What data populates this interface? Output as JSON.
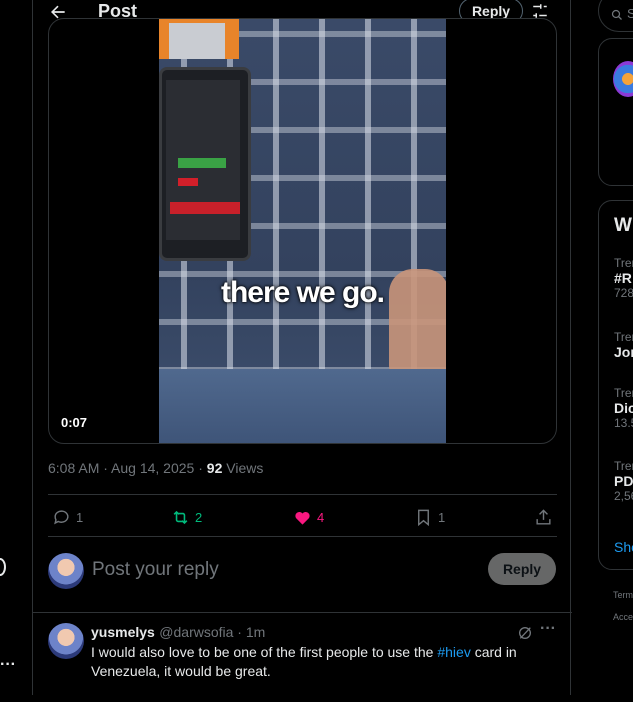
{
  "header": {
    "title": "Post",
    "reply_button": "Reply"
  },
  "media": {
    "caption": "there we go.",
    "duration": "0:07"
  },
  "post_meta": {
    "time": "6:08 AM · Aug 14, 2025 · ",
    "views_count": "92",
    "views_label": " Views"
  },
  "actions": {
    "replies": "1",
    "reposts": "2",
    "likes": "4",
    "bookmarks": "1"
  },
  "colors": {
    "repost": "#00ba7c",
    "like": "#f91880",
    "link": "#1d9bf0",
    "border": "#2f3336"
  },
  "composer": {
    "placeholder": "Post your reply",
    "reply_button": "Reply"
  },
  "comment": {
    "name": "yusmelys",
    "handle": "@darwsofia · 1m",
    "text_before": "I would also love to be one of the first people to use the ",
    "hashtag": "#hiev",
    "text_after": " card in Venezuela, it would be great."
  },
  "right_sidebar": {
    "search_letter": "S",
    "section_title": "W",
    "trends": [
      {
        "meta": "Tren",
        "name": "#R",
        "count": "728"
      },
      {
        "meta": "Tren",
        "name": "Jor",
        "count": ""
      },
      {
        "meta": "Tren",
        "name": "Dic",
        "count": "13.5"
      },
      {
        "meta": "Tren",
        "name": "PD",
        "count": "2,56"
      }
    ],
    "show_more": "Sho",
    "footer_1": "Term",
    "footer_2": "Acce"
  },
  "left_sidebar": {
    "more_dots": "···"
  }
}
